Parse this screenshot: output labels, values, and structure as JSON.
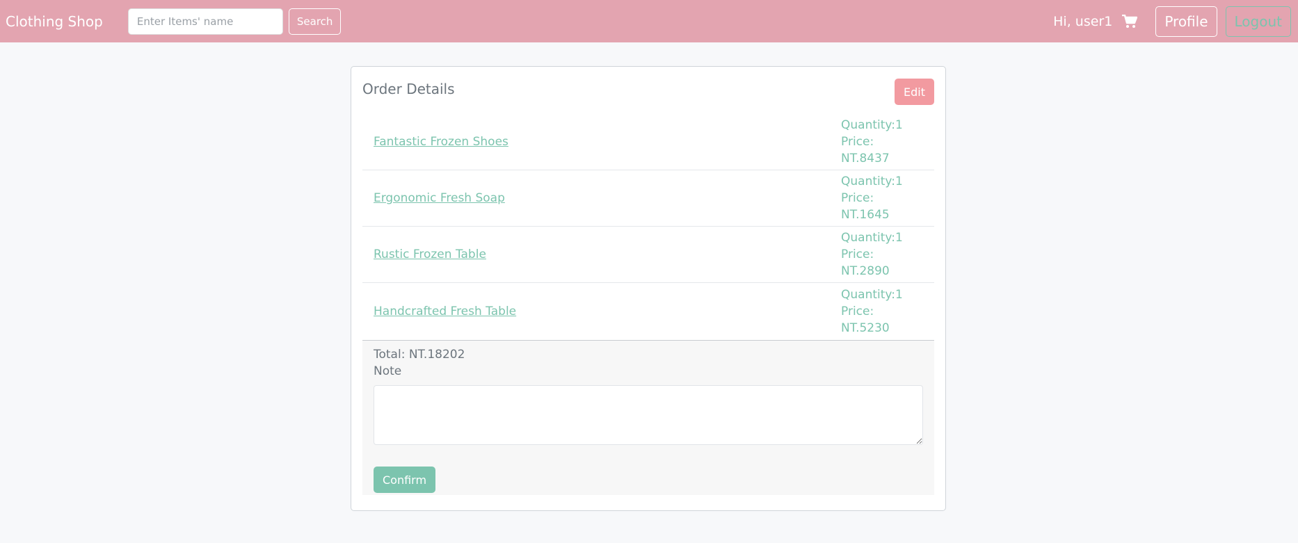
{
  "header": {
    "brand": "Clothing Shop",
    "search_placeholder": "Enter Items' name",
    "search_label": "Search",
    "greeting": "Hi, user1",
    "cart_icon": "shopping-cart-icon",
    "profile_label": "Profile",
    "logout_label": "Logout"
  },
  "order": {
    "title": "Order Details",
    "edit_label": "Edit",
    "items": [
      {
        "name": "Fantastic Frozen Shoes",
        "quantity": "Quantity:1",
        "price": "Price: NT.8437"
      },
      {
        "name": "Ergonomic Fresh Soap",
        "quantity": "Quantity:1",
        "price": "Price: NT.1645"
      },
      {
        "name": "Rustic Frozen Table",
        "quantity": "Quantity:1",
        "price": "Price: NT.2890"
      },
      {
        "name": "Handcrafted Fresh Table",
        "quantity": "Quantity:1",
        "price": "Price: NT.5230"
      }
    ],
    "total": "Total: NT.18202",
    "note_label": "Note",
    "note_value": "",
    "confirm_label": "Confirm"
  },
  "colors": {
    "navbar": "#e3a4b0",
    "accent_green": "#7cc4ae",
    "edit_button": "#f29aa0"
  }
}
